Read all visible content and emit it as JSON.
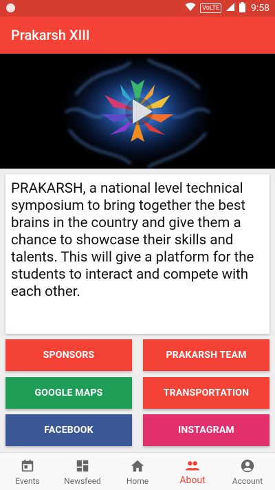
{
  "status_bar": {
    "network_label": "VoLTE",
    "time": "9:58"
  },
  "app_bar": {
    "title": "Prakarsh XIII"
  },
  "hero": {
    "type": "video",
    "icons": [
      "logo-icon",
      "play-icon"
    ]
  },
  "about": {
    "text": "PRAKARSH, a national level technical symposium to bring together the best brains in the country and give them a chance to showcase their skills and talents. This will give a platform for the students to interact and compete with each other."
  },
  "buttons": [
    {
      "label": "SPONSORS",
      "color": "#f44336"
    },
    {
      "label": "PRAKARSH TEAM",
      "color": "#f44336"
    },
    {
      "label": "GOOGLE MAPS",
      "color": "#1e9e57"
    },
    {
      "label": "TRANSPORTATION",
      "color": "#f44336"
    },
    {
      "label": "FACEBOOK",
      "color": "#3a5898"
    },
    {
      "label": "INSTAGRAM",
      "color": "#e1306c"
    }
  ],
  "bottom_nav": {
    "active": "about",
    "items": [
      {
        "label": "Events",
        "icon": "calendar-icon"
      },
      {
        "label": "Newsfeed",
        "icon": "dashboard-icon"
      },
      {
        "label": "Home",
        "icon": "home-icon"
      },
      {
        "label": "About",
        "icon": "people-icon"
      },
      {
        "label": "Account",
        "icon": "account-icon"
      }
    ]
  },
  "colors": {
    "primary": "#f44336",
    "primary_dark": "#d43d2f",
    "nav_inactive": "#666666"
  }
}
